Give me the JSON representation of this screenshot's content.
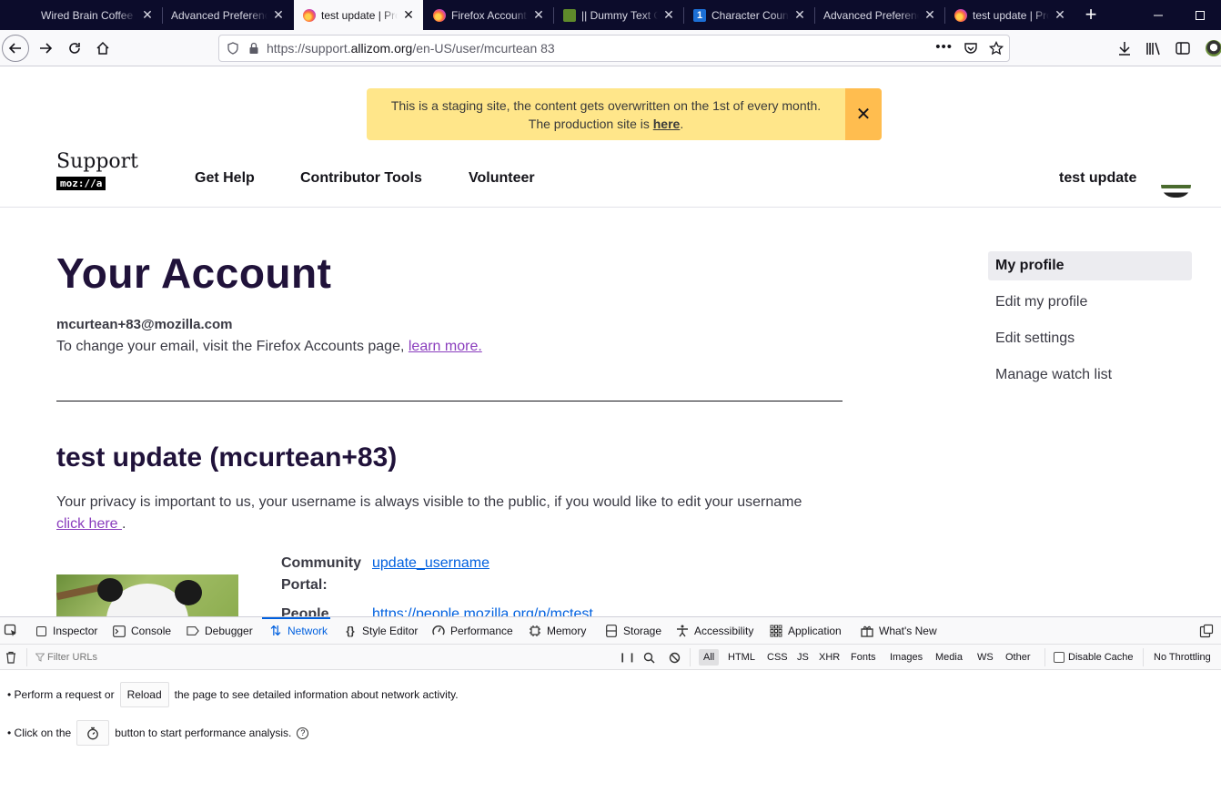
{
  "browser": {
    "tabs": [
      {
        "title": "Wired Brain Coffee",
        "favicon": null,
        "active": false
      },
      {
        "title": "Advanced Preferences",
        "favicon": null,
        "active": false
      },
      {
        "title": "test update | Profile",
        "favicon": "firefox-icon",
        "active": true
      },
      {
        "title": "Firefox Accounts",
        "favicon": "firefox-icon",
        "active": false
      },
      {
        "title": "|| Dummy Text Generator",
        "favicon": "leaf-icon",
        "active": false
      },
      {
        "title": "Character Counter",
        "favicon": "one-icon",
        "active": false
      },
      {
        "title": "Advanced Preferences",
        "favicon": null,
        "active": false
      },
      {
        "title": "test update | Profile",
        "favicon": "firefox-icon",
        "active": false
      }
    ],
    "close_glyph": "✕",
    "new_tab_glyph": "+",
    "url": {
      "scheme": "https://support.",
      "host": "allizom.org",
      "path": "/en-US/user/mcurtean 83"
    }
  },
  "page": {
    "banner": {
      "line1": "This is a staging site, the content gets overwritten on the 1st of every month.",
      "line2_prefix": "The production site is ",
      "line2_link": "here",
      "line2_suffix": ".",
      "close": "✕",
      "color": "#ffe68a"
    },
    "logo": {
      "support": "Support",
      "mozilla": "moz://a"
    },
    "nav": {
      "get_help": "Get Help",
      "contributor_tools": "Contributor Tools",
      "volunteer": "Volunteer"
    },
    "user_display_name": "test update",
    "title": "Your Account",
    "email": "mcurtean+83@mozilla.com",
    "email_note": "To change your email, visit the Firefox Accounts page, ",
    "email_note_link": "learn more.",
    "profile_heading": "test update (mcurtean+83)",
    "privacy_text": "Your privacy is important to us, your username is always visible to the public, if you would like to edit your username ",
    "privacy_link": "click here ",
    "privacy_suffix": ".",
    "profile_fields": [
      {
        "label_line1": "Community",
        "label_line2": "Portal:",
        "value": "update_username"
      },
      {
        "label_line1": "People",
        "label_line2": "",
        "value": "https://people.mozilla.org/p/mctest"
      }
    ],
    "sidebar": [
      {
        "label": "My profile",
        "active": true
      },
      {
        "label": "Edit my profile",
        "active": false
      },
      {
        "label": "Edit settings",
        "active": false
      },
      {
        "label": "Manage watch list",
        "active": false
      }
    ]
  },
  "devtools": {
    "tabs": [
      {
        "label": "Inspector",
        "icon": "inspector-icon"
      },
      {
        "label": "Console",
        "icon": "console-icon"
      },
      {
        "label": "Debugger",
        "icon": "debugger-icon"
      },
      {
        "label": "Network",
        "icon": "network-icon",
        "active": true
      },
      {
        "label": "Style Editor",
        "icon": "style-editor-icon"
      },
      {
        "label": "Performance",
        "icon": "performance-icon"
      },
      {
        "label": "Memory",
        "icon": "memory-icon"
      },
      {
        "label": "Storage",
        "icon": "storage-icon"
      },
      {
        "label": "Accessibility",
        "icon": "accessibility-icon"
      },
      {
        "label": "Application",
        "icon": "application-icon"
      },
      {
        "label": "What's New",
        "icon": "whats-new-icon"
      }
    ],
    "filter_placeholder": "Filter URLs",
    "filter_types": [
      "All",
      "HTML",
      "CSS",
      "JS",
      "XHR",
      "Fonts",
      "Images",
      "Media",
      "WS",
      "Other"
    ],
    "active_filter": "All",
    "disable_cache": "Disable Cache",
    "throttling": "No Throttling",
    "msg1_prefix": "• Perform a request or",
    "msg1_button": "Reload",
    "msg1_suffix": "the page to see detailed information about network activity.",
    "msg2_prefix": "• Click on the",
    "msg2_suffix": "button to start performance analysis.",
    "accent": "#0060df"
  }
}
